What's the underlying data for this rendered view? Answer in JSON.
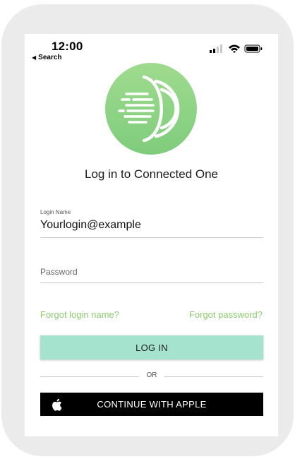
{
  "status_bar": {
    "time": "12:00",
    "back_label": "Search",
    "back_icon": "back-triangle-icon",
    "icons": [
      "signal-icon",
      "wifi-icon",
      "battery-icon"
    ]
  },
  "logo": {
    "icon": "connected-one-logo",
    "colors": [
      "#9ad98b",
      "#7ac97a"
    ]
  },
  "title": "Log in to Connected One",
  "login_field": {
    "label": "Login Name",
    "value": "Yourlogin@example"
  },
  "password_field": {
    "placeholder": "Password"
  },
  "links": {
    "forgot_login": "Forgot login name?",
    "forgot_password": "Forgot password?"
  },
  "login_button": {
    "label": "LOG IN"
  },
  "divider": {
    "label": "OR"
  },
  "apple_button": {
    "label": "CONTINUE WITH APPLE",
    "icon": "apple-icon"
  },
  "colors": {
    "accent_green": "#8dcc6e",
    "login_button_bg": "#a6e3cf",
    "apple_button_bg": "#000000"
  }
}
